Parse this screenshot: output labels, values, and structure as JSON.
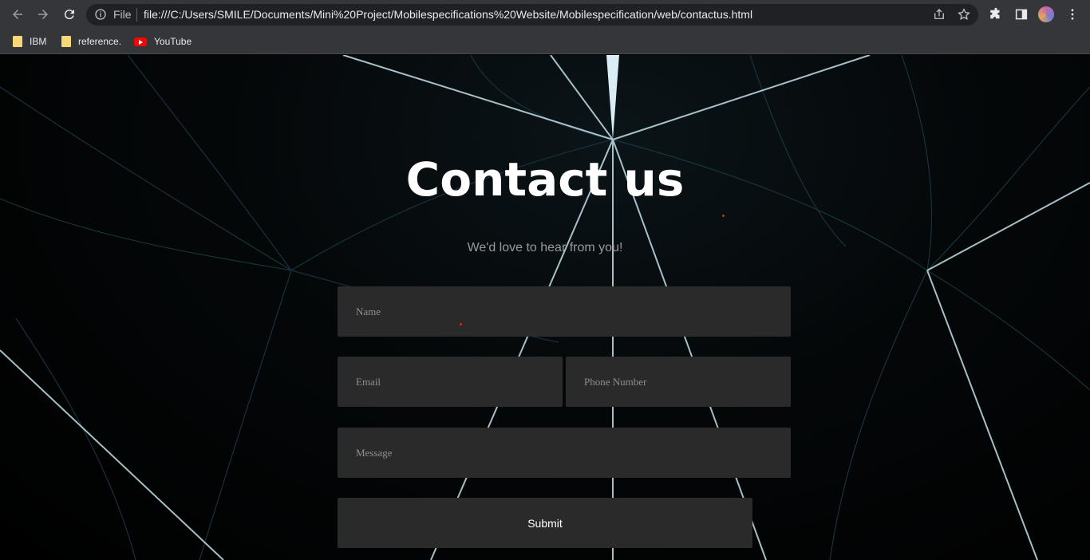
{
  "browser": {
    "scheme_label": "File",
    "url": "file:///C:/Users/SMILE/Documents/Mini%20Project/Mobilespecifications%20Website/Mobilespecification/web/contactus.html",
    "bookmarks": [
      {
        "label": "IBM",
        "icon": "folder-icon"
      },
      {
        "label": "reference.",
        "icon": "folder-icon"
      },
      {
        "label": "YouTube",
        "icon": "youtube-icon"
      }
    ]
  },
  "page": {
    "title": "Contact us",
    "subtitle": "We'd love to hear from you!",
    "form": {
      "name_placeholder": "Name",
      "email_placeholder": "Email",
      "phone_placeholder": "Phone Number",
      "message_placeholder": "Message",
      "submit_label": "Submit"
    }
  }
}
